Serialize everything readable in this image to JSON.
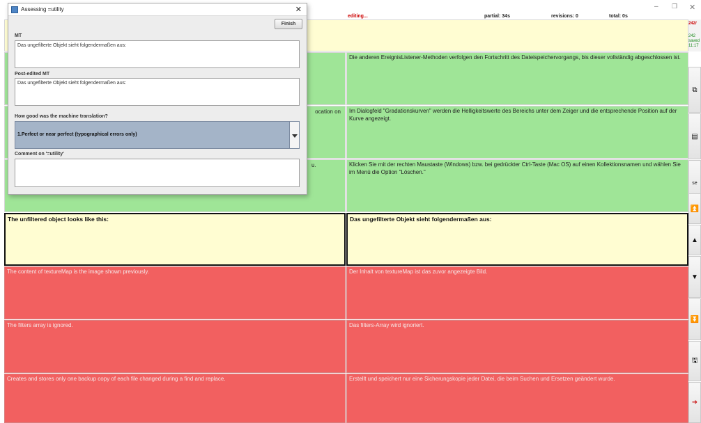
{
  "status": {
    "editing": "editing...",
    "partial": "partial: 34s",
    "revisions": "revisions: 0",
    "total": "total: 0s"
  },
  "window_controls": {
    "minimize": "–",
    "maximize": "❐",
    "close": "✕"
  },
  "side_info": {
    "counter": "242/",
    "line2": "242",
    "line3": "saved",
    "line4": "11:17"
  },
  "segments": [
    {
      "source": "",
      "target": "Die anderen EreignisListener-Methoden verfolgen den Fortschritt des Dateispeichervorgangs, bis dieser vollständig abgeschlossen ist.",
      "state": "green"
    },
    {
      "source": "ocation on",
      "target": "Im Dialogfeld \"Gradationskurven\" werden die Helligkeitswerte des Bereichs unter dem Zeiger und die entsprechende Position auf der Kurve angezeigt.",
      "state": "green"
    },
    {
      "source": "u.",
      "target": "Klicken Sie mit der rechten Maustaste (Windows) bzw. bei gedrückter Ctrl-Taste (Mac OS) auf einen Kollektionsnamen und wählen Sie im Menü die Option \"Löschen.\"",
      "state": "green"
    },
    {
      "source": "The unfiltered object looks like this:",
      "target": "Das ungefilterte Objekt sieht folgendermaßen aus:",
      "state": "yellow"
    },
    {
      "source": "The content of textureMap is the image shown previously.",
      "target": "Der Inhalt von textureMap ist das zuvor angezeigte Bild.",
      "state": "red"
    },
    {
      "source": "The filters array is ignored.",
      "target": "Das filters-Array wird ignoriert.",
      "state": "red"
    },
    {
      "source": "Creates and stores only one backup copy of each file changed during a find and replace.",
      "target": "Erstellt und speichert nur eine Sicherungskopie jeder Datei, die beim Suchen und Ersetzen geändert wurde.",
      "state": "red"
    }
  ],
  "toolbar": [
    {
      "icon": "copy-icon",
      "glyph": "⧉"
    },
    {
      "icon": "paste-icon",
      "glyph": "▤"
    },
    {
      "icon": "search-icon",
      "glyph": "se"
    },
    {
      "icon": "first-segment-icon",
      "glyph": "⏫"
    },
    {
      "icon": "previous-segment-icon",
      "glyph": "▲"
    },
    {
      "icon": "next-segment-icon",
      "glyph": "▼"
    },
    {
      "icon": "last-segment-icon",
      "glyph": "⏬"
    },
    {
      "icon": "save-icon",
      "glyph": "🖫"
    },
    {
      "icon": "exit-icon",
      "glyph": "➜"
    }
  ],
  "dialog": {
    "title": "Assessing =utility",
    "finish_label": "Finish",
    "mt_label": "MT",
    "mt_text": "Das ungefilterte Objekt sieht folgendermaßen aus:",
    "post_edited_label": "Post-edited MT",
    "post_edited_text": "Das ungefilterte Objekt sieht folgendermaßen aus:",
    "question_label": "How good was the machine translation?",
    "selected_rating": "1.Perfect or near perfect (typographical errors only)",
    "comment_label": "Comment on '=utility'",
    "comment_text": ""
  }
}
